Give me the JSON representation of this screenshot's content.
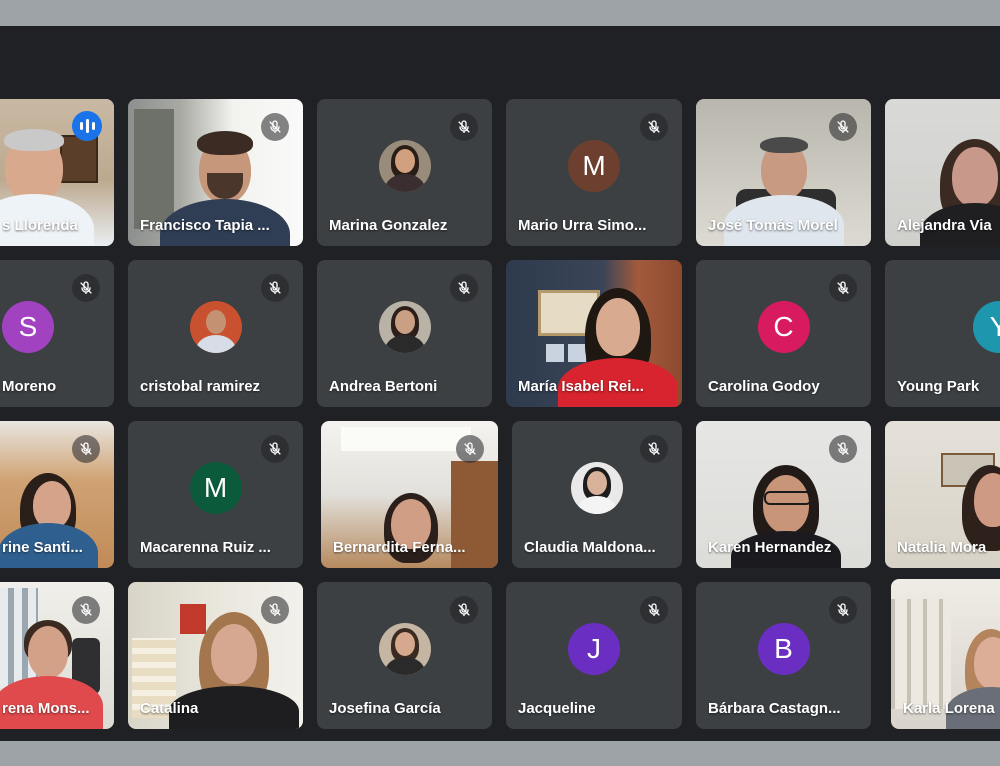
{
  "meeting": {
    "colors": {
      "frame": "#9ea3a7",
      "stage": "#202124",
      "tile": "#3c4043",
      "speaking_badge": "#1a73e8"
    },
    "participants": [
      {
        "name": "Francisco Llorenda",
        "display": "s Llorenda",
        "type": "video",
        "speaking": true
      },
      {
        "name": "Francisco Tapia ...",
        "display": "Francisco Tapia ...",
        "type": "video",
        "muted": true
      },
      {
        "name": "Marina Gonzalez",
        "display": "Marina Gonzalez",
        "type": "photo",
        "muted": true
      },
      {
        "name": "Mario Urra Simo...",
        "display": "Mario Urra Simo...",
        "type": "avatar",
        "letter": "M",
        "color": "#6d3f2f",
        "muted": true
      },
      {
        "name": "José Tomás Morel",
        "display": "José Tomás Morel",
        "type": "video",
        "muted": true
      },
      {
        "name": "Alejandra Via",
        "display": "Alejandra Via",
        "type": "video",
        "muted": false
      },
      {
        "name": "S Moreno",
        "display": "Moreno",
        "type": "avatar",
        "letter": "S",
        "color": "#a142c1",
        "muted": true
      },
      {
        "name": "cristobal ramirez",
        "display": "cristobal ramirez",
        "type": "photo",
        "muted": true
      },
      {
        "name": "Andrea Bertoni",
        "display": "Andrea Bertoni",
        "type": "photo",
        "muted": true
      },
      {
        "name": "María Isabel Rei...",
        "display": "María Isabel Rei...",
        "type": "video",
        "muted": false
      },
      {
        "name": "Carolina Godoy",
        "display": "Carolina Godoy",
        "type": "avatar",
        "letter": "C",
        "color": "#d81b60",
        "muted": true
      },
      {
        "name": "Young Park",
        "display": "Young Park",
        "type": "avatar",
        "letter": "Y",
        "color": "#1e96ad",
        "muted": false
      },
      {
        "name": "Catherine Santi...",
        "display": "rine Santi...",
        "type": "video",
        "muted": true
      },
      {
        "name": "Macarenna Ruiz ...",
        "display": "Macarenna Ruiz ...",
        "type": "avatar",
        "letter": "M",
        "color": "#0c5a3c",
        "muted": true
      },
      {
        "name": "Bernardita Ferna...",
        "display": "Bernardita Ferna...",
        "type": "video",
        "muted": true
      },
      {
        "name": "Claudia Maldona...",
        "display": "Claudia Maldona...",
        "type": "photo",
        "muted": true
      },
      {
        "name": "Karen Hernandez",
        "display": "Karen Hernandez",
        "type": "video",
        "muted": true
      },
      {
        "name": "Natalia Mora",
        "display": "Natalia Mora",
        "type": "video",
        "muted": false
      },
      {
        "name": "Lorena Mons...",
        "display": "rena Mons...",
        "type": "video",
        "muted": true
      },
      {
        "name": "Catalina",
        "display": "Catalina",
        "type": "video",
        "muted": true
      },
      {
        "name": "Josefina García",
        "display": "Josefina García",
        "type": "photo",
        "muted": true
      },
      {
        "name": "Jacqueline",
        "display": "Jacqueline",
        "type": "avatar",
        "letter": "J",
        "color": "#6a2fc2",
        "muted": true
      },
      {
        "name": "Bárbara Castagn...",
        "display": "Bárbara Castagn...",
        "type": "avatar",
        "letter": "B",
        "color": "#6a2fc2",
        "muted": true
      },
      {
        "name": "Karla Lorena",
        "display": "Karla Lorena",
        "type": "video",
        "muted": false
      }
    ]
  }
}
